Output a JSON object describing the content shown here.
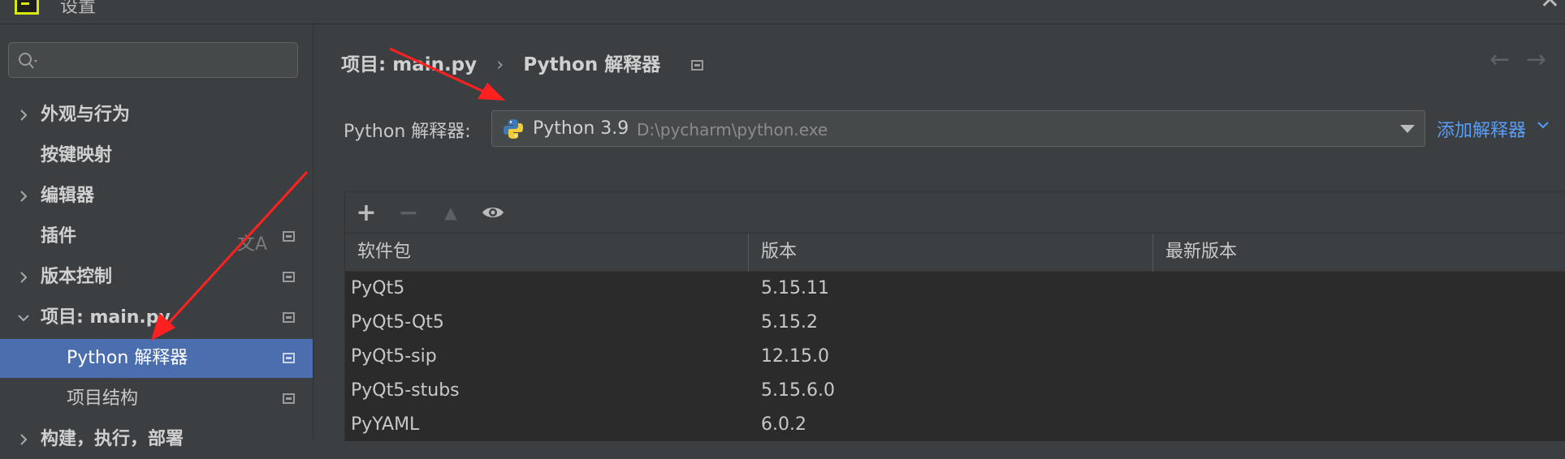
{
  "window": {
    "title": "设置",
    "close_glyph": "✕"
  },
  "sidebar": {
    "search": {
      "value": "",
      "placeholder": ""
    },
    "items": [
      {
        "label": "外观与行为",
        "expandable": true,
        "expanded": false
      },
      {
        "label": "按键映射",
        "expandable": false
      },
      {
        "label": "编辑器",
        "expandable": true,
        "expanded": false
      },
      {
        "label": "插件",
        "expandable": false,
        "icon": "translate-icon"
      },
      {
        "label": "版本控制",
        "expandable": true,
        "expanded": false
      },
      {
        "label": "项目: main.py",
        "expandable": true,
        "expanded": true
      },
      {
        "label": "Python 解释器",
        "sub": true,
        "selected": true
      },
      {
        "label": "项目结构",
        "sub": true
      },
      {
        "label": "构建，执行，部署",
        "expandable": true,
        "expanded": false
      }
    ]
  },
  "main": {
    "breadcrumb": {
      "parent": "项目: main.py",
      "separator": "›",
      "current": "Python 解释器"
    },
    "nav": {
      "back": "←",
      "forward": "→"
    },
    "interpreter": {
      "label": "Python 解释器:",
      "name": "Python 3.9",
      "path": "D:\\pycharm\\python.exe",
      "add_label": "添加解释器"
    },
    "toolbar": {
      "add": "+",
      "remove": "−",
      "upgrade": "▲",
      "show": "eye-icon"
    },
    "table": {
      "headers": [
        "软件包",
        "版本",
        "最新版本"
      ],
      "rows": [
        {
          "package": "PyQt5",
          "version": "5.15.11",
          "latest": ""
        },
        {
          "package": "PyQt5-Qt5",
          "version": "5.15.2",
          "latest": ""
        },
        {
          "package": "PyQt5-sip",
          "version": "12.15.0",
          "latest": ""
        },
        {
          "package": "PyQt5-stubs",
          "version": "5.15.6.0",
          "latest": ""
        },
        {
          "package": "PyYAML",
          "version": "6.0.2",
          "latest": ""
        }
      ]
    }
  },
  "colors": {
    "background": "#3c3f41",
    "selection": "#4b6eaf",
    "link": "#589df6",
    "annotation_arrow": "#ff2020",
    "logo": "#d7e80d"
  }
}
